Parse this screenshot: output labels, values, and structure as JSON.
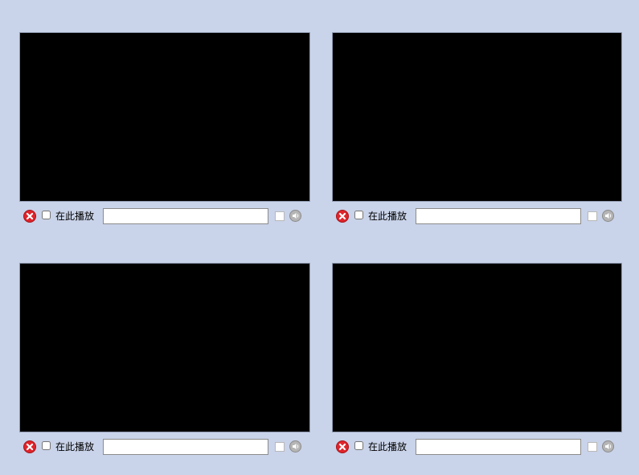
{
  "page": {
    "background_color": "#c9d3e9"
  },
  "players": [
    {
      "play_here_label": "在此播放",
      "play_here_checked": false,
      "url_value": "",
      "extra_checked": false,
      "icons": [
        "close-icon",
        "speaker-icon"
      ]
    },
    {
      "play_here_label": "在此播放",
      "play_here_checked": false,
      "url_value": "",
      "extra_checked": false,
      "icons": [
        "close-icon",
        "speaker-icon"
      ]
    },
    {
      "play_here_label": "在此播放",
      "play_here_checked": false,
      "url_value": "",
      "extra_checked": false,
      "icons": [
        "close-icon",
        "speaker-icon"
      ]
    },
    {
      "play_here_label": "在此播放",
      "play_here_checked": false,
      "url_value": "",
      "extra_checked": false,
      "icons": [
        "close-icon",
        "speaker-icon"
      ]
    }
  ],
  "colors": {
    "video_background": "#000000",
    "close_icon_red": "#e0242b",
    "speaker_icon_gray": "#a0a0a0"
  }
}
